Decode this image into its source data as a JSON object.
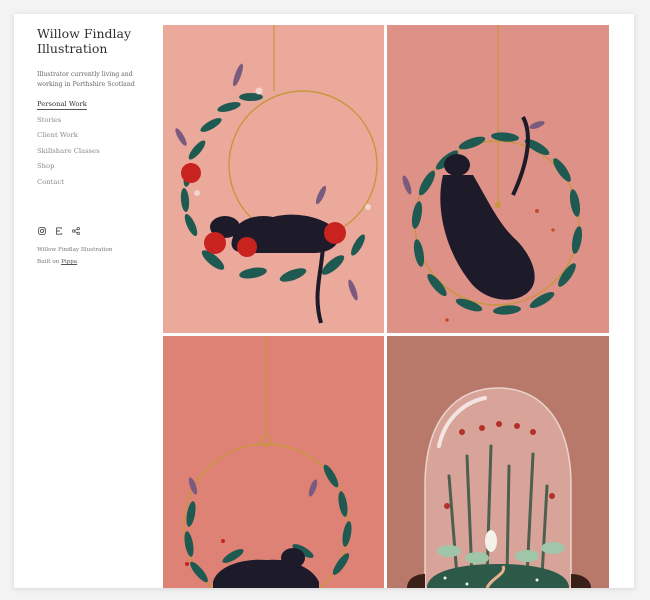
{
  "site": {
    "title_line1": "Willow Findlay",
    "title_line2": "Illustration",
    "tagline": "Illustrator currently living and working in Perthshire Scotland"
  },
  "nav": {
    "items": [
      {
        "label": "Personal Work",
        "active": true
      },
      {
        "label": "Stories",
        "active": false
      },
      {
        "label": "Client Work",
        "active": false
      },
      {
        "label": "Skillshare Classes",
        "active": false
      },
      {
        "label": "Shop",
        "active": false
      },
      {
        "label": "Contact",
        "active": false
      }
    ]
  },
  "social": {
    "icons": [
      "instagram-icon",
      "etsy-icon",
      "share-icon"
    ]
  },
  "footer": {
    "owner": "Willow Findlay Illustration",
    "built_prefix": "Built on",
    "built_link": "Pippa"
  },
  "gallery": {
    "tiles": [
      {
        "alt": "panther-wreath-red-roses",
        "bg": "#eba99c"
      },
      {
        "alt": "panther-climbing-wreath",
        "bg": "#de9186"
      },
      {
        "alt": "panther-lying-wreath",
        "bg": "#de8275"
      },
      {
        "alt": "glass-dome-garden",
        "bg": "#b8796a"
      }
    ]
  },
  "colors": {
    "accent_text": "#333333",
    "muted_text": "#8a8a8a",
    "page_bg": "#f3f3f3",
    "card_bg": "#ffffff"
  }
}
